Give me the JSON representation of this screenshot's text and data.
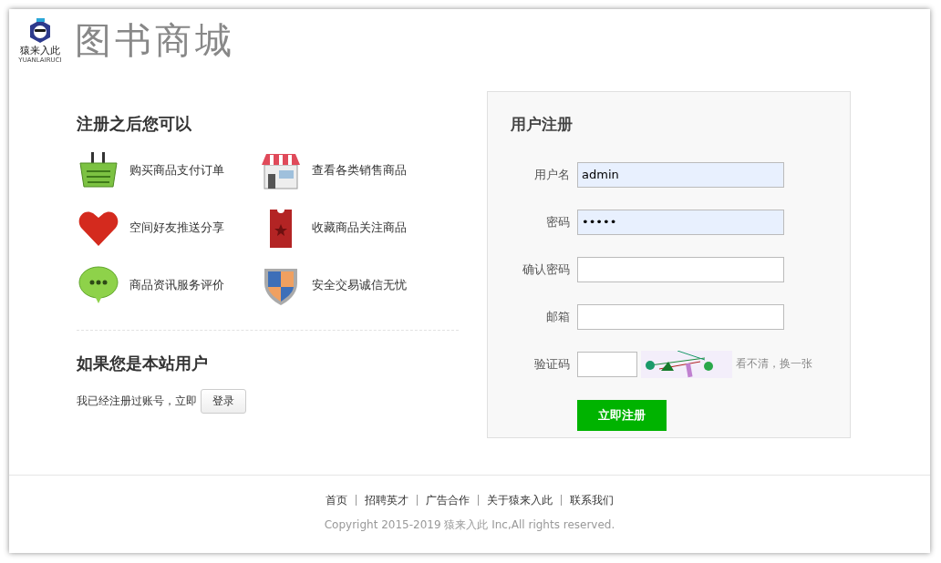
{
  "logo": {
    "brand": "猿来入此",
    "brand_latin": "YUANLAIRUCI",
    "site_title": "图书商城"
  },
  "benefits": {
    "title": "注册之后您可以",
    "items": [
      {
        "kind": "basket",
        "label": "购买商品支付订单"
      },
      {
        "kind": "store",
        "label": "查看各类销售商品"
      },
      {
        "kind": "heart",
        "label": "空间好友推送分享"
      },
      {
        "kind": "ticket",
        "label": "收藏商品关注商品"
      },
      {
        "kind": "chat",
        "label": "商品资讯服务评价"
      },
      {
        "kind": "shield",
        "label": "安全交易诚信无忧"
      }
    ]
  },
  "login_prompt": {
    "title": "如果您是本站用户",
    "text": "我已经注册过账号，立即",
    "button": "登录"
  },
  "register": {
    "title": "用户注册",
    "fields": [
      {
        "kind": "text",
        "label": "用户名",
        "value": "admin",
        "autofilled": true
      },
      {
        "kind": "text",
        "label": "密码",
        "value": "•••••",
        "autofilled": true
      },
      {
        "kind": "text",
        "label": "确认密码",
        "autofilled": false
      },
      {
        "kind": "text",
        "label": "邮箱",
        "autofilled": false
      },
      {
        "kind": "captcha",
        "label": "验证码",
        "autofilled": false,
        "refresh": "看不清，换一张"
      }
    ],
    "submit": "立即注册"
  },
  "footer": {
    "links": [
      "首页",
      "招聘英才",
      "广告合作",
      "关于猿来入此",
      "联系我们"
    ],
    "copyright": "Copyright 2015-2019 猿来入此 Inc,All rights reserved."
  }
}
